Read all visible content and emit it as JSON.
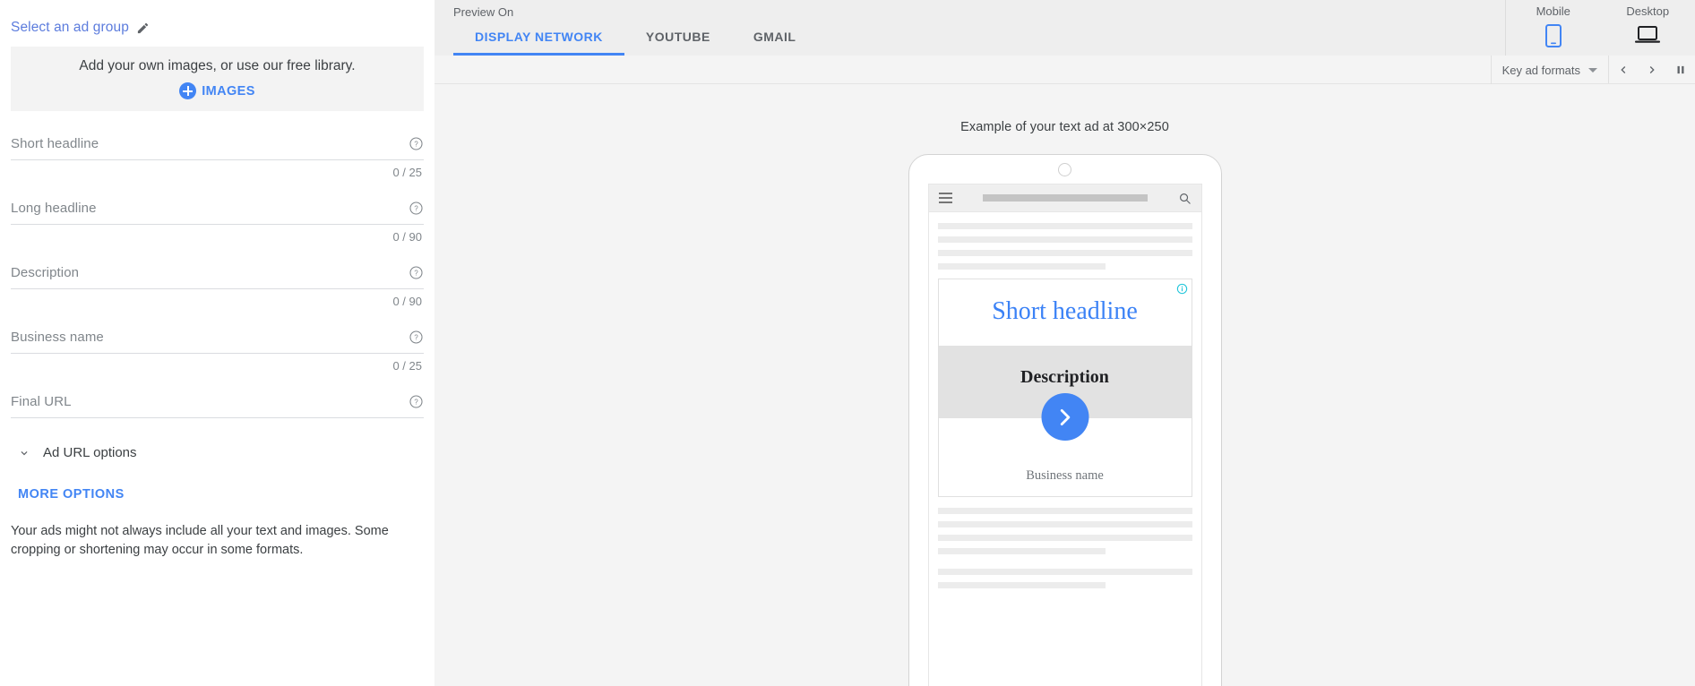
{
  "left_panel": {
    "ad_group_link": "Select an ad group",
    "edit_icon": "pencil-icon",
    "dropzone": {
      "text": "Add your own images, or use our free library.",
      "images_button": "IMAGES"
    },
    "fields": [
      {
        "label": "Short headline",
        "value": "",
        "counter": "0 / 25",
        "help": "help-icon"
      },
      {
        "label": "Long headline",
        "value": "",
        "counter": "0 / 90",
        "help": "help-icon"
      },
      {
        "label": "Description",
        "value": "",
        "counter": "0 / 90",
        "help": "help-icon"
      },
      {
        "label": "Business name",
        "value": "",
        "counter": "0 / 25",
        "help": "help-icon"
      },
      {
        "label": "Final URL",
        "value": "",
        "counter": "",
        "help": "help-icon"
      }
    ],
    "ad_url_options": "Ad URL options",
    "more_options": "MORE OPTIONS",
    "disclaimer": "Your ads might not always include all your text and images. Some cropping or shortening may occur in some formats."
  },
  "preview": {
    "header_label": "Preview On",
    "tabs": [
      {
        "label": "DISPLAY NETWORK",
        "active": true
      },
      {
        "label": "YOUTUBE",
        "active": false
      },
      {
        "label": "GMAIL",
        "active": false
      }
    ],
    "devices": [
      {
        "label": "Mobile",
        "icon": "mobile-phone-icon",
        "active": true
      },
      {
        "label": "Desktop",
        "icon": "laptop-icon",
        "active": false
      }
    ],
    "toolbar": {
      "ad_formats_label": "Key ad formats",
      "prev_icon": "chevron-left-icon",
      "next_icon": "chevron-right-icon",
      "pause_icon": "pause-icon"
    },
    "example_caption": "Example of your text ad at 300×250",
    "phone": {
      "browser": {
        "menu_icon": "hamburger-icon",
        "search_icon": "search-icon"
      },
      "lines_above": [
        100,
        100,
        100,
        66
      ],
      "lines_below_a": [
        100,
        100,
        100,
        66
      ],
      "lines_below_b": [
        100,
        66
      ]
    },
    "ad_card": {
      "info_icon": "info-icon",
      "headline": "Short headline",
      "description": "Description",
      "cta_icon": "chevron-right-arrow-icon",
      "business_name": "Business name"
    }
  },
  "colors": {
    "accent_blue": "#4285f4",
    "link_blue": "#5c7cdd",
    "info_cyan": "#1fc5da",
    "ad_headline_blue": "#3b82f6",
    "panel_gray": "#eeeeee",
    "stage_gray": "#f4f4f4"
  }
}
